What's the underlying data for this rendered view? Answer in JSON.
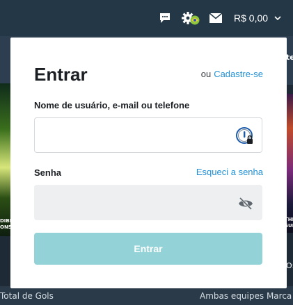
{
  "header": {
    "balance": "R$ 0,00",
    "icons": [
      "chat-icon",
      "gear-icon",
      "mail-icon",
      "chevron-down-icon"
    ],
    "badge_color": "#8cc63f"
  },
  "background": {
    "left_promo_text": "DIBI ONSA",
    "right_promo_text": "THE SUI",
    "right_top_text": "te",
    "right_mid_text": "O:",
    "bottom_left": "Total de Gols",
    "bottom_right": "Ambas equipes Marca"
  },
  "login": {
    "title": "Entrar",
    "or": "ou",
    "signup_link": "Cadastre-se",
    "username_label": "Nome de usuário, e-mail ou telefone",
    "username_value": "",
    "password_label": "Senha",
    "forgot_link": "Esqueci a senha",
    "password_value": "",
    "submit": "Entrar"
  },
  "colors": {
    "link": "#1f8fd6",
    "submit_disabled": "#93d3d8",
    "header_bg": "#243746"
  }
}
